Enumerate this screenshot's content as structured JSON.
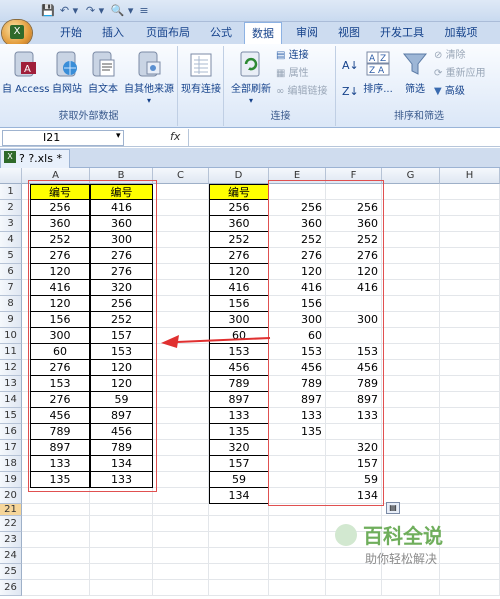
{
  "qat": {
    "btns": [
      "💾",
      "↶ ▾",
      "↷ ▾",
      "🔍 ▾",
      "≡"
    ]
  },
  "tabs": [
    "开始",
    "插入",
    "页面布局",
    "公式",
    "数据",
    "审阅",
    "视图",
    "开发工具",
    "加载项"
  ],
  "ribbon": {
    "external": {
      "access": "自 Access",
      "web": "自网站",
      "text": "自文本",
      "other": "自其他来源",
      "label": "获取外部数据"
    },
    "existing": "现有连接",
    "refresh": "全部刷新",
    "connect": {
      "conn": "连接",
      "props": "属性",
      "edit": "编辑链接",
      "label": "连接"
    },
    "sort": {
      "sort": "排序...",
      "filter": "筛选",
      "clear": "清除",
      "reapply": "重新应用",
      "advanced": "高级",
      "label": "排序和筛选"
    }
  },
  "formula": {
    "namebox": "I21",
    "fx": "fx"
  },
  "doc": {
    "tab": "? ?.xls *"
  },
  "columns": [
    "A",
    "B",
    "C",
    "D",
    "E",
    "F",
    "G",
    "H"
  ],
  "rows": [
    "1",
    "2",
    "3",
    "4",
    "5",
    "6",
    "7",
    "8",
    "9",
    "10",
    "11",
    "12",
    "13",
    "14",
    "15",
    "16",
    "17",
    "18",
    "19",
    "20",
    "21",
    "22",
    "23",
    "24",
    "25",
    "26"
  ],
  "colA": [
    "编号",
    "256",
    "360",
    "252",
    "276",
    "120",
    "416",
    "120",
    "156",
    "300",
    "60",
    "276",
    "153",
    "276",
    "456",
    "789",
    "897",
    "133",
    "135"
  ],
  "colB": [
    "编号",
    "416",
    "360",
    "300",
    "276",
    "276",
    "320",
    "256",
    "252",
    "157",
    "153",
    "120",
    "120",
    "59",
    "897",
    "456",
    "789",
    "134",
    "133"
  ],
  "colD": [
    "编号",
    "256",
    "360",
    "252",
    "276",
    "120",
    "416",
    "156",
    "300",
    "60",
    "153",
    "456",
    "789",
    "897",
    "133",
    "135",
    "320",
    "157",
    "59",
    "134"
  ],
  "colE": [
    "",
    "256",
    "360",
    "252",
    "276",
    "120",
    "416",
    "156",
    "300",
    "60",
    "153",
    "456",
    "789",
    "897",
    "133",
    "135",
    "",
    "",
    "",
    ""
  ],
  "colF": [
    "",
    "256",
    "360",
    "252",
    "276",
    "120",
    "416",
    "",
    "300",
    "",
    "153",
    "456",
    "789",
    "897",
    "133",
    "",
    "320",
    "157",
    "59",
    "134"
  ],
  "watermark": {
    "title": "百科全说",
    "sub": "助你轻松解决"
  },
  "colors": {
    "header_fill": "#ffff00",
    "red_box": "#e05050",
    "arrow": "#e03030"
  }
}
